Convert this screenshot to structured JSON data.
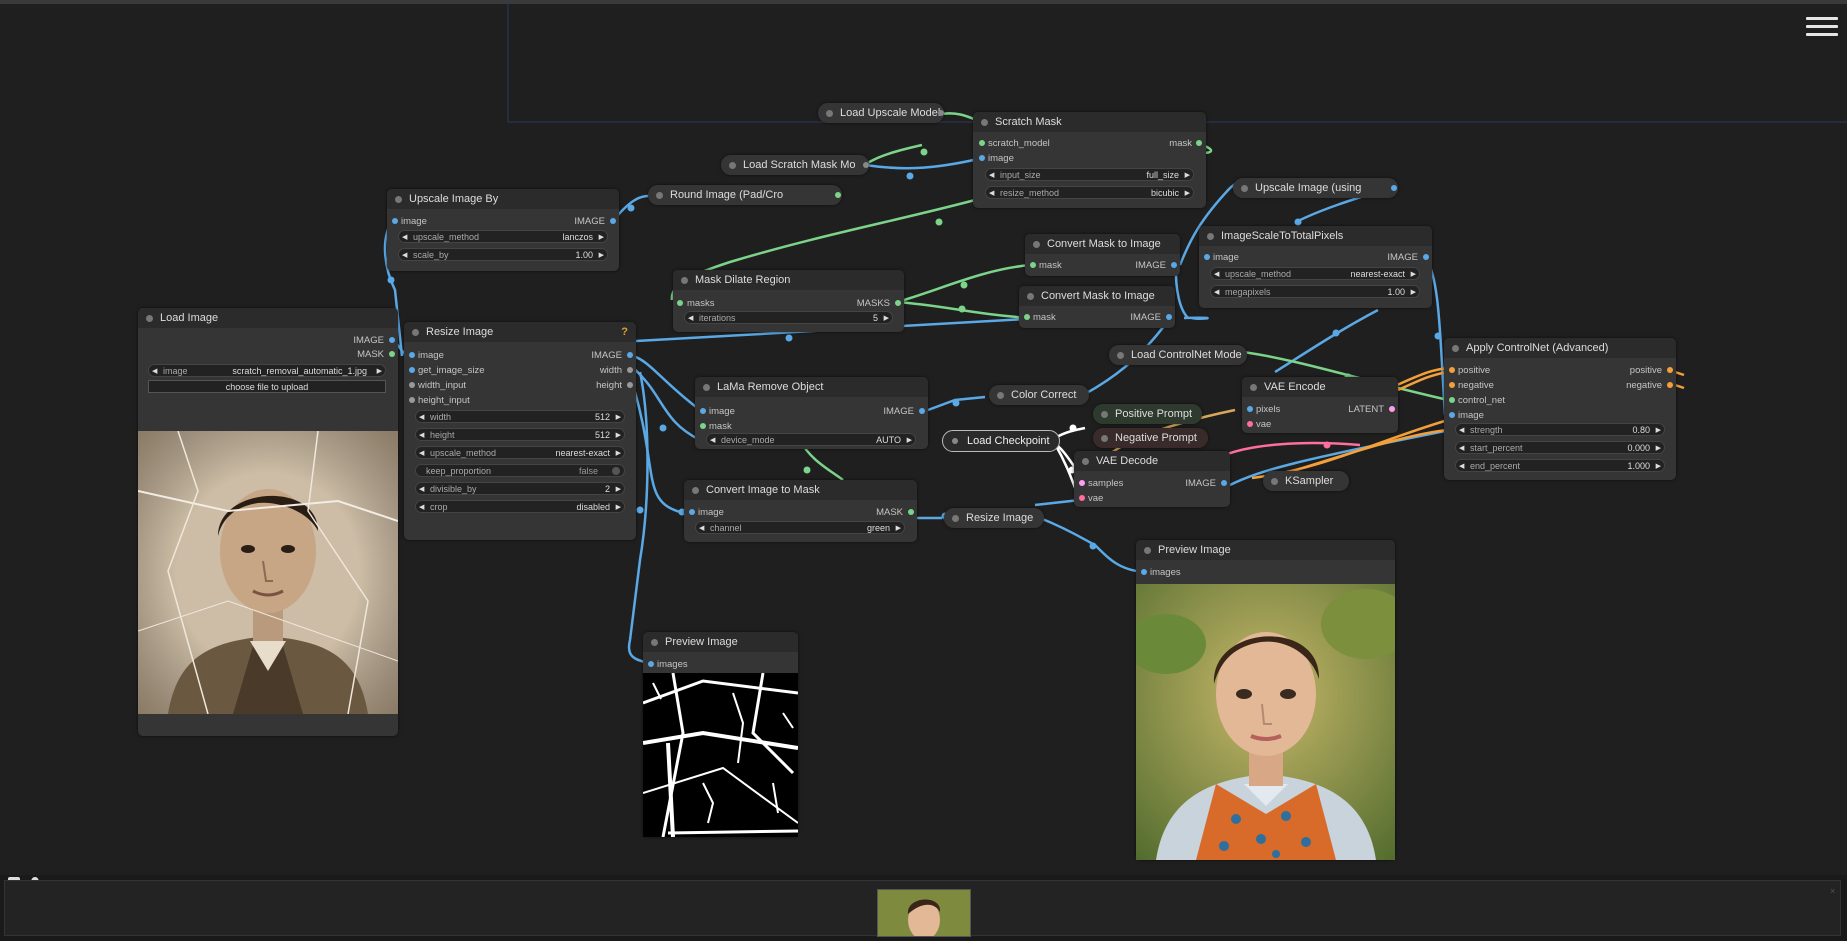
{
  "menu": {
    "icon": "hamburger-menu-icon"
  },
  "colors": {
    "image_link": "#5aa9e6",
    "mask_link": "#7cd38a",
    "model_link": "#d8a85a",
    "conditioning_link": "#f4a03a",
    "vae_link": "#ff6e9e"
  },
  "nodes": {
    "load_upscale_model": {
      "title": "Load Upscale Model"
    },
    "scratch_mask": {
      "title": "Scratch Mask",
      "in_scratch_model": "scratch_model",
      "in_image": "image",
      "out_mask": "mask",
      "input_size_label": "input_size",
      "input_size_value": "full_size",
      "resize_method_label": "resize_method",
      "resize_method_value": "bicubic"
    },
    "load_scratch_mask_model": {
      "title": "Load Scratch Mask Mo"
    },
    "round_image": {
      "title": "Round Image (Pad/Cro"
    },
    "upscale_image_by": {
      "title": "Upscale Image By",
      "in_image": "image",
      "out_image": "IMAGE",
      "upscale_method_label": "upscale_method",
      "upscale_method_value": "lanczos",
      "scale_by_label": "scale_by",
      "scale_by_value": "1.00"
    },
    "upscale_image_using": {
      "title": "Upscale Image (using"
    },
    "image_scale_total_pixels": {
      "title": "ImageScaleToTotalPixels",
      "in_image": "image",
      "out_image": "IMAGE",
      "upscale_method_label": "upscale_method",
      "upscale_method_value": "nearest-exact",
      "megapixels_label": "megapixels",
      "megapixels_value": "1.00"
    },
    "convert_mask_1": {
      "title": "Convert Mask to Image",
      "in_mask": "mask",
      "out_image": "IMAGE"
    },
    "convert_mask_2": {
      "title": "Convert Mask to Image",
      "in_mask": "mask",
      "out_image": "IMAGE"
    },
    "mask_dilate": {
      "title": "Mask Dilate Region",
      "in_masks": "masks",
      "out_masks": "MASKS",
      "iterations_label": "iterations",
      "iterations_value": "5"
    },
    "load_image": {
      "title": "Load Image",
      "out_image": "IMAGE",
      "out_mask": "MASK",
      "image_label": "image",
      "image_value": "scratch_removal_automatic_1.jpg",
      "upload_label": "choose file to upload"
    },
    "resize_image_main": {
      "title": "Resize Image",
      "help": "?",
      "in_image": "image",
      "in_get_image_size": "get_image_size",
      "in_width_input": "width_input",
      "in_height_input": "height_input",
      "out_image": "IMAGE",
      "out_width": "width",
      "out_height": "height",
      "width_label": "width",
      "width_value": "512",
      "height_label": "height",
      "height_value": "512",
      "upscale_method_label": "upscale_method",
      "upscale_method_value": "nearest-exact",
      "keep_proportion_label": "keep_proportion",
      "keep_proportion_value": "false",
      "divisible_by_label": "divisible_by",
      "divisible_by_value": "2",
      "crop_label": "crop",
      "crop_value": "disabled"
    },
    "lama": {
      "title": "LaMa Remove Object",
      "in_image": "image",
      "in_mask": "mask",
      "out_image": "IMAGE",
      "device_mode_label": "device_mode",
      "device_mode_value": "AUTO"
    },
    "convert_image_to_mask": {
      "title": "Convert Image to Mask",
      "in_image": "image",
      "out_mask": "MASK",
      "channel_label": "channel",
      "channel_value": "green"
    },
    "color_correct": {
      "title": "Color Correct"
    },
    "load_controlnet": {
      "title": "Load ControlNet Mode"
    },
    "vae_encode": {
      "title": "VAE Encode",
      "in_pixels": "pixels",
      "in_vae": "vae",
      "out_latent": "LATENT"
    },
    "positive_prompt": {
      "title": "Positive Prompt"
    },
    "negative_prompt": {
      "title": "Negative Prompt"
    },
    "load_checkpoint": {
      "title": "Load Checkpoint"
    },
    "vae_decode": {
      "title": "VAE Decode",
      "in_samples": "samples",
      "in_vae": "vae",
      "out_image": "IMAGE"
    },
    "ksampler": {
      "title": "KSampler"
    },
    "resize_image_small": {
      "title": "Resize Image"
    },
    "apply_controlnet": {
      "title": "Apply ControlNet (Advanced)",
      "in_positive": "positive",
      "in_negative": "negative",
      "in_control_net": "control_net",
      "in_image": "image",
      "out_positive": "positive",
      "out_negative": "negative",
      "strength_label": "strength",
      "strength_value": "0.80",
      "start_label": "start_percent",
      "start_value": "0.000",
      "end_label": "end_percent",
      "end_value": "1.000"
    },
    "preview_mask": {
      "title": "Preview Image",
      "in_images": "images"
    },
    "preview_result": {
      "title": "Preview Image",
      "in_images": "images"
    }
  },
  "bottom": {
    "queue_icon": "queue-icon",
    "bell_icon": "bell-icon"
  }
}
